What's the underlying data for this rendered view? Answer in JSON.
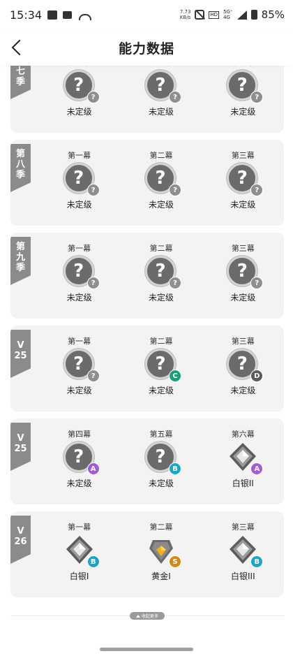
{
  "status_bar": {
    "time": "15:34",
    "left_icons": [
      "message-icon",
      "mail-icon",
      "missed-call-icon"
    ],
    "net_speed_value": "7.73",
    "net_speed_unit": "KB/s",
    "hd_label": "HD",
    "net_type_top": "5G⁺",
    "net_type_bottom": "4G",
    "battery": "85%"
  },
  "header": {
    "title": "能力数据"
  },
  "colors": {
    "badge_unknown": "#8f8f8f",
    "badge_A": "#a35bd6",
    "badge_B": "#1aa6c4",
    "badge_C": "#13a07a",
    "badge_D": "#5a5a5a",
    "badge_S": "#d28a1b",
    "tag_bg": "#8b8b8b",
    "card_bg": "#f3f3f3"
  },
  "seasons": [
    {
      "tag": [
        "第",
        "七",
        "季"
      ],
      "acts": [
        {
          "label": "第一幕",
          "rank": "未定级",
          "icon": "unranked-icon",
          "badge": "?"
        },
        {
          "label": "第二幕",
          "rank": "未定级",
          "icon": "unranked-icon",
          "badge": "?"
        },
        {
          "label": "第三幕",
          "rank": "未定级",
          "icon": "unranked-icon",
          "badge": "?"
        }
      ]
    },
    {
      "tag": [
        "第",
        "八",
        "季"
      ],
      "acts": [
        {
          "label": "第一幕",
          "rank": "未定级",
          "icon": "unranked-icon",
          "badge": "?"
        },
        {
          "label": "第二幕",
          "rank": "未定级",
          "icon": "unranked-icon",
          "badge": "?"
        },
        {
          "label": "第三幕",
          "rank": "未定级",
          "icon": "unranked-icon",
          "badge": "?"
        }
      ]
    },
    {
      "tag": [
        "第",
        "九",
        "季"
      ],
      "acts": [
        {
          "label": "第一幕",
          "rank": "未定级",
          "icon": "unranked-icon",
          "badge": "?"
        },
        {
          "label": "第二幕",
          "rank": "未定级",
          "icon": "unranked-icon",
          "badge": "?"
        },
        {
          "label": "第三幕",
          "rank": "未定级",
          "icon": "unranked-icon",
          "badge": "?"
        }
      ]
    },
    {
      "tag": [
        "V",
        "25"
      ],
      "acts": [
        {
          "label": "第一幕",
          "rank": "未定级",
          "icon": "unranked-icon",
          "badge": "?"
        },
        {
          "label": "第二幕",
          "rank": "未定级",
          "icon": "unranked-icon",
          "badge": "C"
        },
        {
          "label": "第三幕",
          "rank": "未定级",
          "icon": "unranked-icon",
          "badge": "D"
        }
      ]
    },
    {
      "tag": [
        "V",
        "25"
      ],
      "acts": [
        {
          "label": "第四幕",
          "rank": "未定级",
          "icon": "unranked-icon",
          "badge": "A"
        },
        {
          "label": "第五幕",
          "rank": "未定级",
          "icon": "unranked-icon",
          "badge": "B"
        },
        {
          "label": "第六幕",
          "rank": "白银II",
          "icon": "silver-rank-icon",
          "badge": "A"
        }
      ]
    },
    {
      "tag": [
        "V",
        "26"
      ],
      "acts": [
        {
          "label": "第一幕",
          "rank": "白银I",
          "icon": "silver-rank-icon",
          "badge": "B"
        },
        {
          "label": "第二幕",
          "rank": "黄金I",
          "icon": "gold-rank-icon",
          "badge": "S"
        },
        {
          "label": "第三幕",
          "rank": "白银III",
          "icon": "silver-rank-icon",
          "badge": "B"
        }
      ]
    }
  ],
  "footer": {
    "collapse_label": "收起更多"
  }
}
